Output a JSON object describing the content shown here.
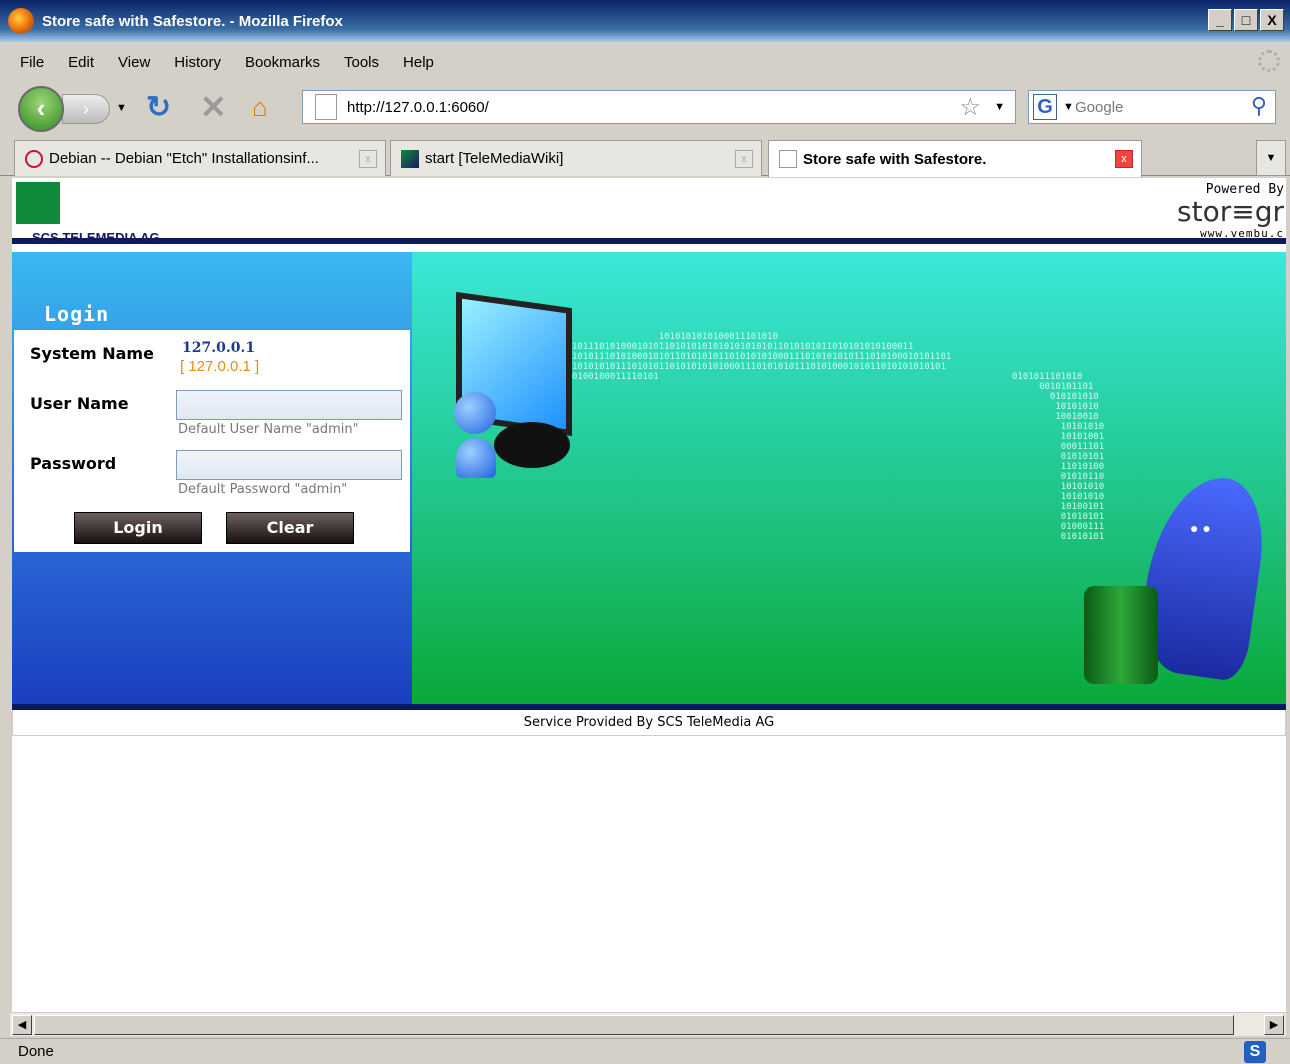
{
  "window": {
    "title": "Store safe with Safestore. - Mozilla Firefox",
    "buttons": [
      "_",
      "□",
      "X"
    ]
  },
  "menu": [
    "File",
    "Edit",
    "View",
    "History",
    "Bookmarks",
    "Tools",
    "Help"
  ],
  "nav": {
    "url": "http://127.0.0.1:6060/",
    "search_placeholder": "Google"
  },
  "tabs": [
    {
      "label": "Debian -- Debian \"Etch\" Installationsinf..."
    },
    {
      "label": "start [TeleMediaWiki]"
    },
    {
      "label": "Store safe with Safestore."
    }
  ],
  "page": {
    "logo_text": "SCS TELEMEDIA AG",
    "powered_by": "Powered By",
    "brand": "stor≡gr",
    "brand_url": "www.vembu.c",
    "login_heading": "Login",
    "system_name_label": "System Name",
    "system_name_value": "127.0.0.1",
    "system_name_ip": "[ 127.0.0.1 ]",
    "username_label": "User Name",
    "username_hint": "Default User Name \"admin\"",
    "password_label": "Password",
    "password_hint": "Default Password \"admin\"",
    "login_button": "Login",
    "clear_button": "Clear",
    "footer": "Service Provided By SCS TeleMedia AG"
  },
  "status": {
    "text": "Done",
    "icon": "S"
  }
}
